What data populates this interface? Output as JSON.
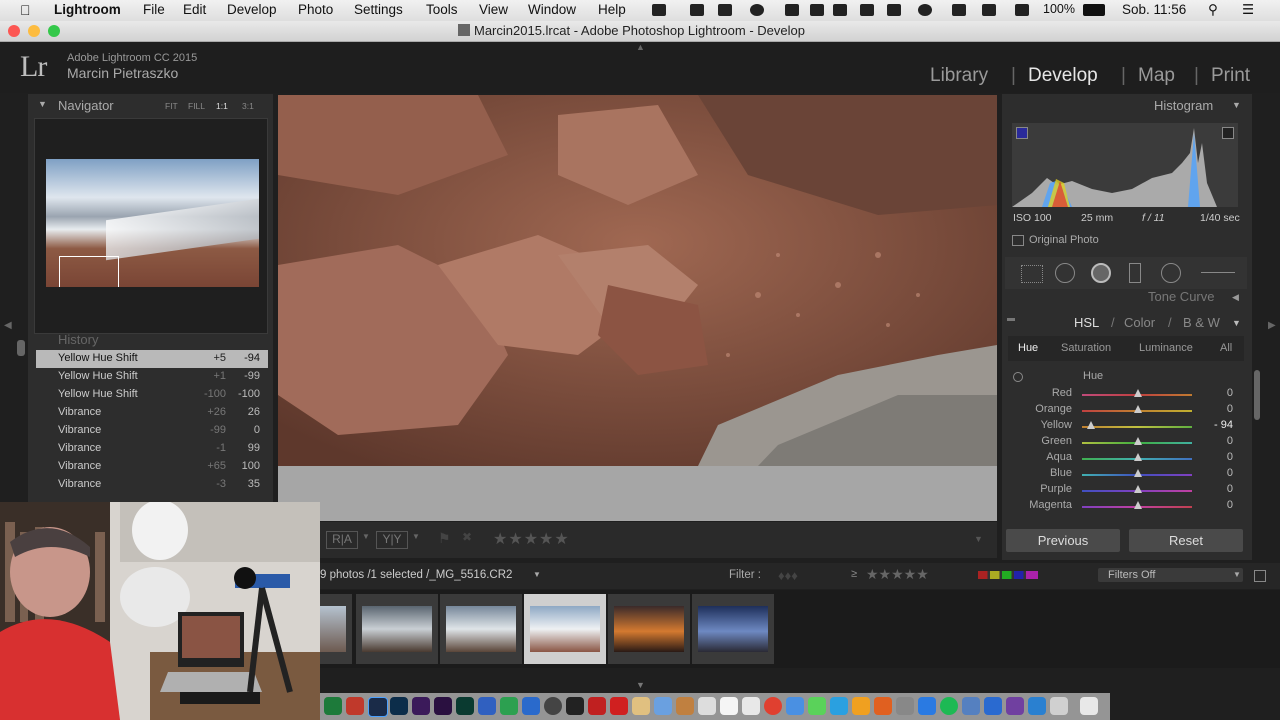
{
  "menubar": {
    "app": "Lightroom",
    "items": [
      "File",
      "Edit",
      "Develop",
      "Photo",
      "Settings",
      "Tools",
      "View",
      "Window",
      "Help"
    ],
    "battery": "100%",
    "clock": "Sob. 11:56"
  },
  "window": {
    "title": "Marcin2015.lrcat - Adobe Photoshop Lightroom - Develop"
  },
  "identity": {
    "product": "Adobe Lightroom CC 2015",
    "user": "Marcin Pietraszko"
  },
  "modules": [
    "Library",
    "Develop",
    "Map",
    "Print"
  ],
  "navigator": {
    "title": "Navigator",
    "zooms": [
      "FIT",
      "FILL",
      "1:1",
      "3:1"
    ]
  },
  "history": {
    "title": "History",
    "rows": [
      {
        "name": "Yellow Hue Shift",
        "a": "+5",
        "b": "-94"
      },
      {
        "name": "Yellow Hue Shift",
        "a": "+1",
        "b": "-99"
      },
      {
        "name": "Yellow Hue Shift",
        "a": "-100",
        "b": "-100"
      },
      {
        "name": "Vibrance",
        "a": "+26",
        "b": "26"
      },
      {
        "name": "Vibrance",
        "a": "-99",
        "b": "0"
      },
      {
        "name": "Vibrance",
        "a": "-1",
        "b": "99"
      },
      {
        "name": "Vibrance",
        "a": "+65",
        "b": "100"
      },
      {
        "name": "Vibrance",
        "a": "-3",
        "b": "35"
      }
    ]
  },
  "histogram": {
    "title": "Histogram",
    "iso": "ISO 100",
    "focal": "25 mm",
    "aperture": "f / 11",
    "shutter": "1/40 sec",
    "original_photo": "Original Photo"
  },
  "tone_curve": "Tone Curve",
  "hsl": {
    "hsl": "HSL",
    "color": "Color",
    "bw": "B & W",
    "tabs": [
      "Hue",
      "Saturation",
      "Luminance",
      "All"
    ],
    "section": "Hue",
    "sliders": [
      {
        "label": "Red",
        "value": "0",
        "level": 0
      },
      {
        "label": "Orange",
        "value": "0",
        "level": 0
      },
      {
        "label": "Yellow",
        "value": "- 94",
        "level": -94
      },
      {
        "label": "Green",
        "value": "0",
        "level": 0
      },
      {
        "label": "Aqua",
        "value": "0",
        "level": 0
      },
      {
        "label": "Blue",
        "value": "0",
        "level": 0
      },
      {
        "label": "Purple",
        "value": "0",
        "level": 0
      },
      {
        "label": "Magenta",
        "value": "0",
        "level": 0
      }
    ]
  },
  "buttons": {
    "previous": "Previous",
    "reset": "Reset"
  },
  "filmbar": {
    "status": "9 photos /1 selected /_MG_5516.CR2",
    "filter": "Filter :",
    "filters_off": "Filters Off"
  },
  "toolbar": {
    "ra": "R|A",
    "yy": "Y|Y"
  }
}
